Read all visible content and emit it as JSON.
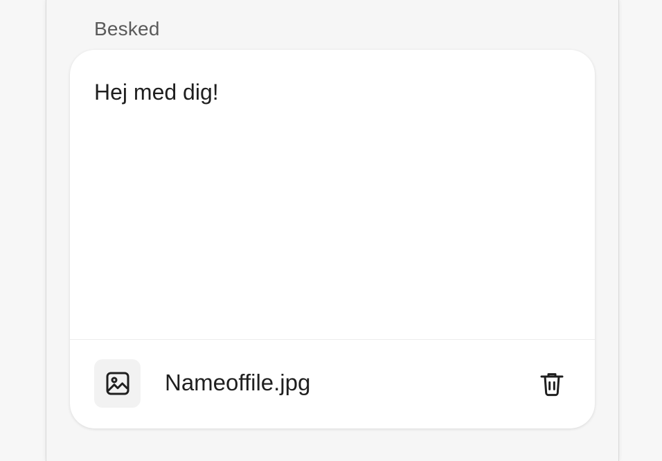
{
  "message_field": {
    "label": "Besked",
    "value": "Hej med dig!"
  },
  "attachment": {
    "file_name": "Nameoffile.jpg",
    "thumb_icon": "image-icon",
    "delete_icon": "trash-icon"
  },
  "colors": {
    "background": "#f7f7f7",
    "card": "#ffffff",
    "text": "#1f1f1f",
    "label": "#5a5a5a"
  }
}
